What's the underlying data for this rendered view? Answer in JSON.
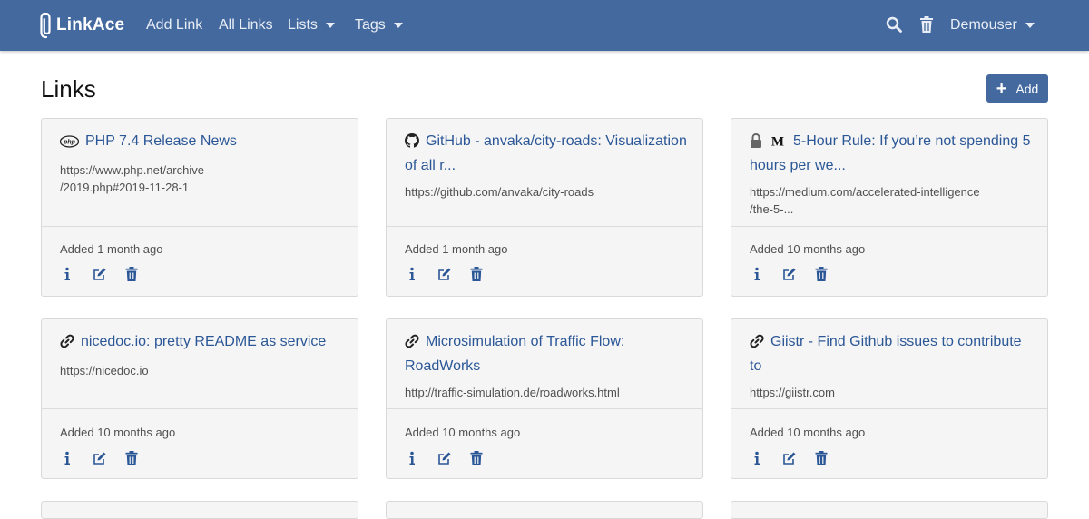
{
  "nav": {
    "brand": "LinkAce",
    "add_link": "Add Link",
    "all_links": "All Links",
    "lists": "Lists",
    "tags": "Tags",
    "user": "Demouser"
  },
  "page": {
    "title": "Links",
    "add_button": "Add"
  },
  "cards": [
    {
      "title": "PHP 7.4 Release News",
      "url": "https://www.php.net/archive/2019.php#2019-11-28-1",
      "url_lines": [
        "https://www.php.net/archive",
        "/2019.php#2019-11-28-1"
      ],
      "added": "Added 1 month ago",
      "icon": "php-icon"
    },
    {
      "title": "GitHub - anvaka/city-roads: Visualization of all r...",
      "url": "https://github.com/anvaka/city-roads",
      "added": "Added 1 month ago",
      "icon": "github-icon"
    },
    {
      "title": "5-Hour Rule: If you’re not spending 5 hours per we...",
      "url": "https://medium.com/accelerated-intelligence/the-5-...",
      "url_lines": [
        "https://medium.com/accelerated-intelligence",
        "/the-5-..."
      ],
      "added": "Added 10 months ago",
      "icon": "medium-icon",
      "private": true
    },
    {
      "title": "nicedoc.io: pretty README as service",
      "url": "https://nicedoc.io",
      "added": "Added 10 months ago",
      "icon": "link-icon"
    },
    {
      "title": "Microsimulation of Traffic Flow: RoadWorks",
      "url": "http://traffic-simulation.de/roadworks.html",
      "added": "Added 10 months ago",
      "icon": "link-icon"
    },
    {
      "title": "Giistr - Find Github issues to contribute to",
      "url": "https://giistr.com",
      "added": "Added 10 months ago",
      "icon": "link-icon"
    }
  ],
  "colors": {
    "navbar": "#44699f",
    "link": "#2b5797",
    "card_bg": "#f5f5f5"
  }
}
